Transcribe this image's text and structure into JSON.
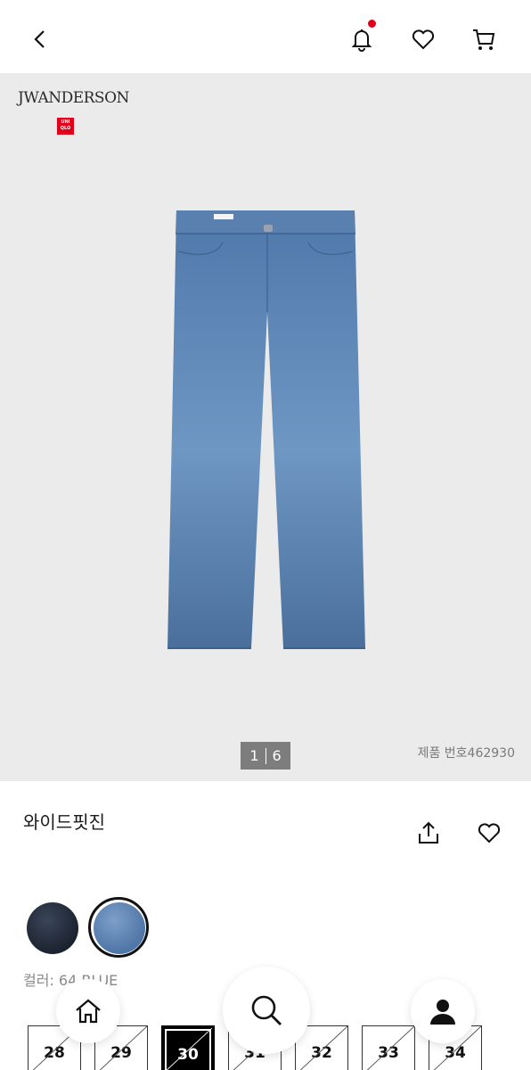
{
  "header": {
    "back_icon": "chevron-left-icon",
    "bell_icon": "bell-icon",
    "heart_icon": "heart-outline-icon",
    "cart_icon": "cart-icon",
    "notification_dot_color": "#e0001a"
  },
  "hero": {
    "brand_text": "JWANDERSON",
    "collab_logo_text": "UNI QLO",
    "pager_current": "1",
    "pager_total": "6",
    "product_number": "제품 번호462930",
    "background": "#ebebeb"
  },
  "product": {
    "title": "와이드핏진",
    "share_icon": "share-icon",
    "favorite_icon": "heart-outline-icon"
  },
  "colors": {
    "label": "컬러: 64 BLUE",
    "swatches": [
      {
        "name": "dark navy",
        "hex": "#1f2735",
        "selected": false
      },
      {
        "name": "blue",
        "hex": "#5d82b1",
        "selected": true
      }
    ]
  },
  "sizes": {
    "items": [
      {
        "label": "28",
        "selected": false,
        "unavailable": true
      },
      {
        "label": "29",
        "selected": false,
        "unavailable": true
      },
      {
        "label": "30",
        "selected": true,
        "unavailable": true
      },
      {
        "label": "31",
        "selected": false,
        "unavailable": true
      },
      {
        "label": "32",
        "selected": false,
        "unavailable": true
      },
      {
        "label": "33",
        "selected": false,
        "unavailable": true
      },
      {
        "label": "34",
        "selected": false,
        "unavailable": true
      }
    ]
  },
  "bottom_nav": {
    "home_icon": "home-icon",
    "search_icon": "search-icon",
    "user_icon": "user-icon"
  }
}
